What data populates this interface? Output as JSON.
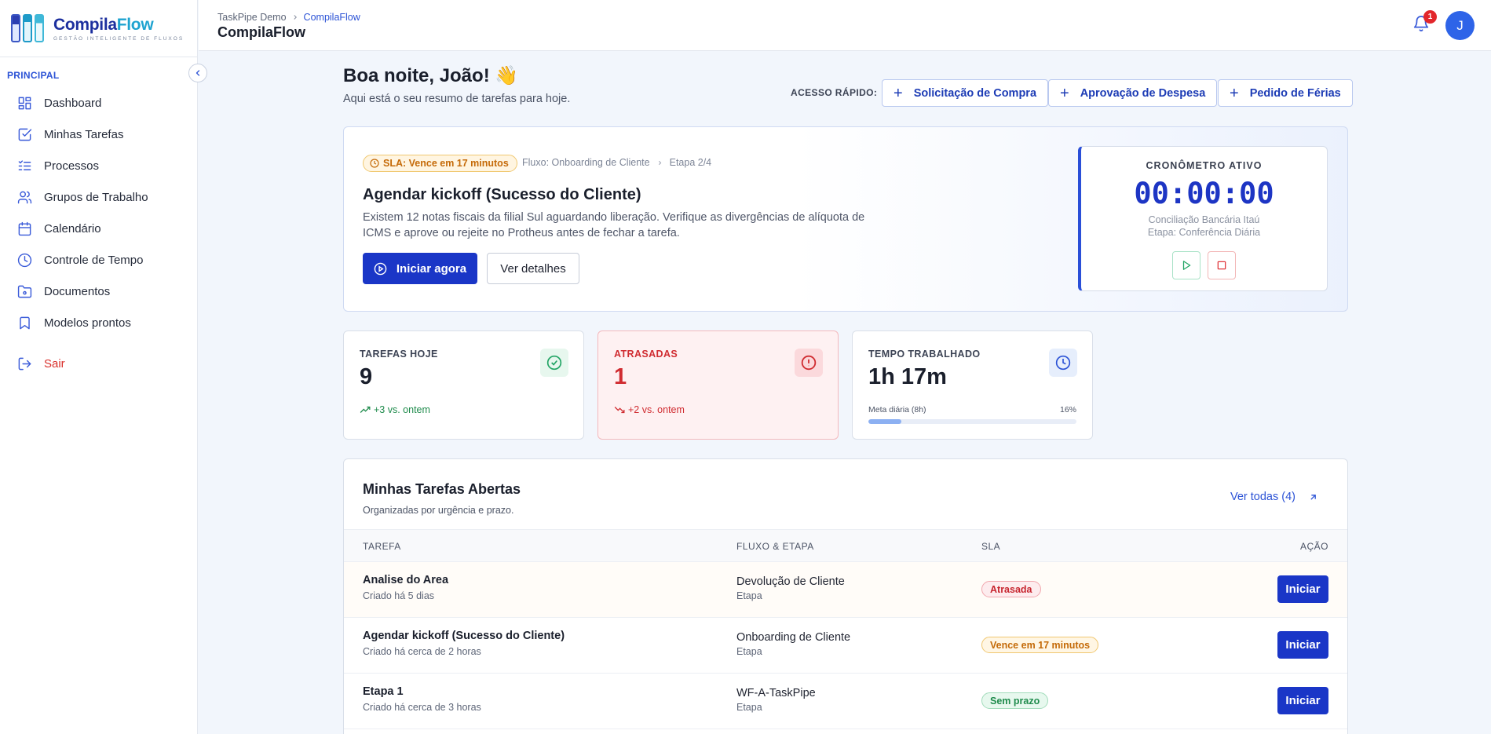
{
  "brand": {
    "name_part1": "Compila",
    "name_part2": "Flow",
    "tagline": "GESTÃO INTELIGENTE DE FLUXOS"
  },
  "sidebar": {
    "section_label": "PRINCIPAL",
    "items": [
      {
        "label": "Dashboard",
        "icon": "grid-icon"
      },
      {
        "label": "Minhas Tarefas",
        "icon": "checkbox-icon"
      },
      {
        "label": "Processos",
        "icon": "list-check-icon"
      },
      {
        "label": "Grupos de Trabalho",
        "icon": "users-icon"
      },
      {
        "label": "Calendário",
        "icon": "calendar-icon"
      },
      {
        "label": "Controle de Tempo",
        "icon": "clock-icon"
      },
      {
        "label": "Documentos",
        "icon": "folder-icon"
      },
      {
        "label": "Modelos prontos",
        "icon": "bookmark-icon"
      }
    ],
    "logout_label": "Sair"
  },
  "topbar": {
    "breadcrumb_root": "TaskPipe Demo",
    "breadcrumb_current": "CompilaFlow",
    "title": "CompilaFlow",
    "notification_count": "1",
    "avatar_initial": "J"
  },
  "greeting": {
    "title": "Boa noite, João! 👋",
    "subtitle": "Aqui está o seu resumo de tarefas para hoje."
  },
  "quick_access": {
    "label": "ACESSO RÁPIDO:",
    "buttons": [
      "Solicitação de Compra",
      "Aprovação de Despesa",
      "Pedido de Férias"
    ]
  },
  "hero": {
    "sla_badge": "SLA: Vence em 17 minutos",
    "flow": "Fluxo: Onboarding de Cliente",
    "stage": "Etapa 2/4",
    "title": "Agendar kickoff (Sucesso do Cliente)",
    "description": "Existem 12 notas fiscais da filial Sul aguardando liberação. Verifique as divergências de alíquota de ICMS e aprove ou rejeite no Protheus antes de fechar a tarefa.",
    "primary_button": "Iniciar agora",
    "secondary_button": "Ver detalhes"
  },
  "timer": {
    "label": "CRONÔMETRO ATIVO",
    "value": "00:00:00",
    "task": "Conciliação Bancária Itaú",
    "stage": "Etapa: Conferência Diária"
  },
  "stats": [
    {
      "label": "TAREFAS HOJE",
      "value": "9",
      "trend": "+3 vs. ontem"
    },
    {
      "label": "ATRASADAS",
      "value": "1",
      "trend": "+2 vs. ontem"
    },
    {
      "label": "TEMPO TRABALHADO",
      "value": "1h 17m",
      "meta_label": "Meta diária (8h)",
      "meta_percent": "16%",
      "meta_fraction": 0.16
    }
  ],
  "colors": {
    "primary": "#1a36c7",
    "accent": "#2c53d6",
    "danger": "#d02c31",
    "success": "#1f8b4c",
    "warning": "#c56a08"
  },
  "tasks": {
    "title": "Minhas Tarefas Abertas",
    "subtitle": "Organizadas por urgência e prazo.",
    "see_all": "Ver todas (4)",
    "columns": [
      "TAREFA",
      "FLUXO & ETAPA",
      "SLA",
      "AÇÃO"
    ],
    "rows": [
      {
        "name": "Analise do Area",
        "created": "Criado há 5 dias",
        "flow": "Devolução de Cliente",
        "stage": "Etapa",
        "sla": "Atrasada",
        "sla_type": "late",
        "action": "Iniciar"
      },
      {
        "name": "Agendar kickoff (Sucesso do Cliente)",
        "created": "Criado há cerca de 2 horas",
        "flow": "Onboarding de Cliente",
        "stage": "Etapa",
        "sla": "Vence em 17 minutos",
        "sla_type": "soon",
        "action": "Iniciar"
      },
      {
        "name": "Etapa 1",
        "created": "Criado há cerca de 3 horas",
        "flow": "WF-A-TaskPipe",
        "stage": "Etapa",
        "sla": "Sem prazo",
        "sla_type": "none",
        "action": "Iniciar"
      }
    ]
  }
}
